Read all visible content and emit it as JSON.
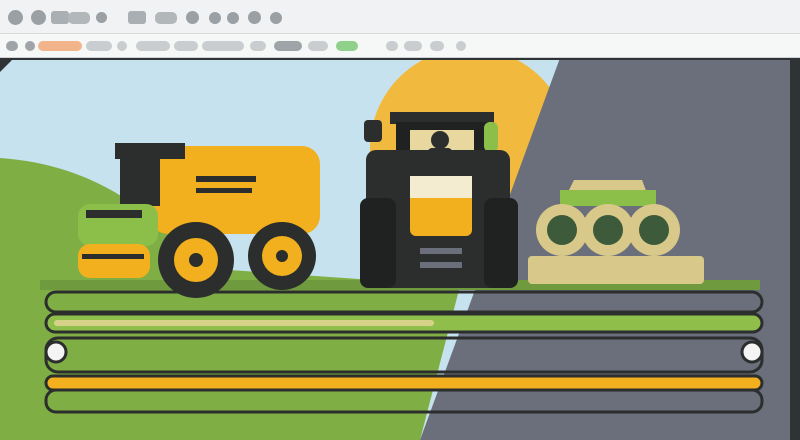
{
  "toolbar": {
    "icons": [
      "circle-icon",
      "circle-icon",
      "shape-icon",
      "brush-icon",
      "drop-icon",
      "camera-icon",
      "folder-icon",
      "circle-icon",
      "palette-icon",
      "circle-icon",
      "circle-icon",
      "circle-icon"
    ]
  },
  "ribbon": {
    "items": [
      "close-tab-icon",
      "back-icon",
      "forward-icon",
      "logo-icon",
      "tab",
      "tab",
      "tab",
      "tab",
      "tab",
      "tab",
      "tab",
      "tab",
      "tab",
      "tab",
      "tab",
      "tab"
    ]
  },
  "canvas": {
    "scene": "tractors-and-crops",
    "colors": {
      "sky": "#c6e2ee",
      "sun": "#f1ba3f",
      "shade": "#6a6f7b",
      "grass": "#7fae44",
      "yellow": "#f2b01e",
      "dark": "#2b2e2c",
      "wheat": "#d8c98a"
    }
  }
}
